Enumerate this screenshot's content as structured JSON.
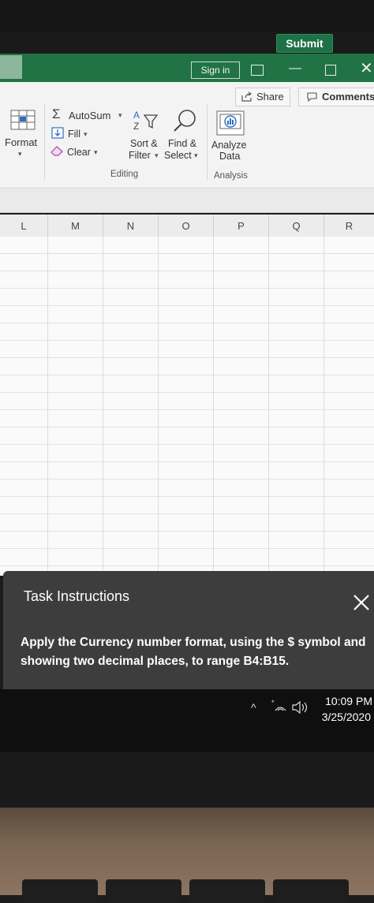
{
  "submit_label": "Submit",
  "titlebar": {
    "sign_in": "Sign in",
    "minimize": "—",
    "close": "✕"
  },
  "ribbon": {
    "share": "Share",
    "comments": "Comments",
    "format": "Format",
    "autosum": "AutoSum",
    "fill": "Fill",
    "clear": "Clear",
    "sort_filter_line1": "Sort &",
    "sort_filter_line2": "Filter",
    "find_select_line1": "Find &",
    "find_select_line2": "Select",
    "analyze_line1": "Analyze",
    "analyze_line2": "Data",
    "group_editing": "Editing",
    "group_analysis": "Analysis"
  },
  "columns": [
    "L",
    "M",
    "N",
    "O",
    "P",
    "Q",
    "R"
  ],
  "task": {
    "title": "Task Instructions",
    "body": "Apply the Currency number format, using the $ symbol and showing two decimal places, to range B4:B15."
  },
  "taskbar": {
    "time": "10:09 PM",
    "date": "3/25/2020"
  },
  "icons": [
    "sum-icon",
    "fill-down-icon",
    "eraser-icon",
    "sort-filter-icon",
    "search-icon",
    "analyze-data-icon",
    "share-icon",
    "comment-icon",
    "close-icon",
    "wifi-icon",
    "volume-icon"
  ]
}
